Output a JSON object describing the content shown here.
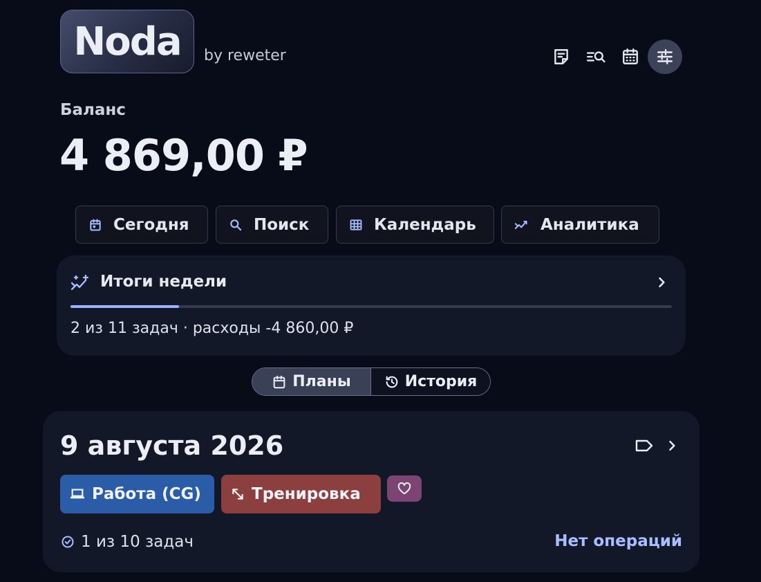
{
  "app": {
    "logo_text": "Noda",
    "byline": "by reweter"
  },
  "header_icons": [
    {
      "name": "notes-icon",
      "active": false
    },
    {
      "name": "search-list-icon",
      "active": false
    },
    {
      "name": "calendar-icon",
      "active": false
    },
    {
      "name": "settings-sliders-icon",
      "active": true
    }
  ],
  "balance": {
    "label": "Баланс",
    "value": "4 869,00 ₽"
  },
  "quick_actions": [
    {
      "label": "Сегодня",
      "icon": "calendar-today-icon"
    },
    {
      "label": "Поиск",
      "icon": "search-icon"
    },
    {
      "label": "Календарь",
      "icon": "grid-icon"
    },
    {
      "label": "Аналитика",
      "icon": "analytics-icon"
    }
  ],
  "week_summary": {
    "title": "Итоги недели",
    "summary": "2 из 11 задач · расходы -4 860,00 ₽",
    "progress_fraction": 0.18,
    "accent_color": "#9db3ff"
  },
  "view_toggle": {
    "plans_label": "Планы",
    "history_label": "История",
    "selected": "plans"
  },
  "day": {
    "date": "9 августа 2026",
    "tags": [
      {
        "label": "Работа (CG)",
        "icon": "laptop-icon",
        "color": "#2a5ca8"
      },
      {
        "label": "Тренировка",
        "icon": "expand-arrows-icon",
        "color": "#8b3f3e"
      },
      {
        "label": "",
        "icon": "heart-icon",
        "color": "#7c4472"
      }
    ],
    "tasks_count": "1 из 10 задач",
    "operations": "Нет операций"
  }
}
